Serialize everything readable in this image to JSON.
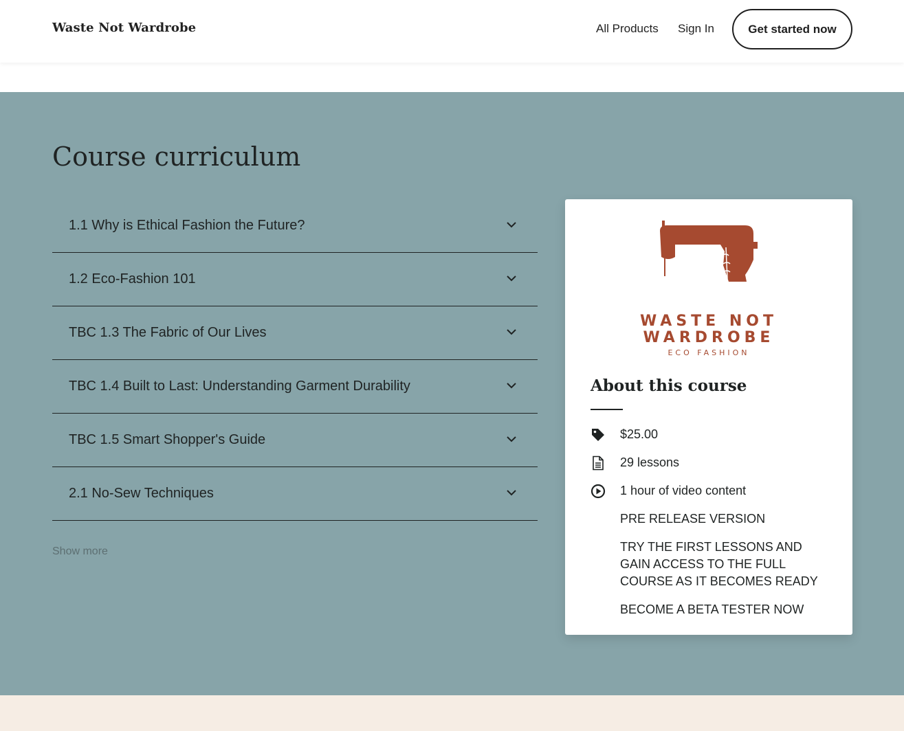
{
  "header": {
    "brand": "Waste Not Wardrobe",
    "nav": {
      "all_products": "All Products",
      "sign_in": "Sign In"
    },
    "cta": "Get started now"
  },
  "curriculum": {
    "title": "Course curriculum",
    "items": [
      {
        "label": "1.1 Why is Ethical Fashion the Future?"
      },
      {
        "label": "1.2 Eco-Fashion 101"
      },
      {
        "label": "TBC 1.3 The Fabric of Our Lives"
      },
      {
        "label": "TBC 1.4 Built to Last: Understanding Garment Durability"
      },
      {
        "label": "TBC 1.5 Smart Shopper's Guide"
      },
      {
        "label": "2.1 No-Sew Techniques"
      }
    ],
    "show_more": "Show more"
  },
  "about": {
    "logo": {
      "line1": "WASTE NOT",
      "line2": "WARDROBE",
      "line3": "ECO FASHION",
      "color": "#a64a30"
    },
    "title": "About this course",
    "price": "$25.00",
    "lessons": "29 lessons",
    "video": "1 hour of video content",
    "note1": "PRE RELEASE VERSION",
    "note2": "TRY THE FIRST LESSONS AND GAIN ACCESS TO THE FULL COURSE AS IT BECOMES READY",
    "note3": "BECOME A BETA TESTER NOW",
    "icons": {
      "price": "price-tag-icon",
      "lessons": "document-icon",
      "video": "play-circle-icon"
    }
  },
  "colors": {
    "section_bg": "#87a4a9",
    "footer_bg": "#f6ede4",
    "accent": "#a64a30"
  }
}
